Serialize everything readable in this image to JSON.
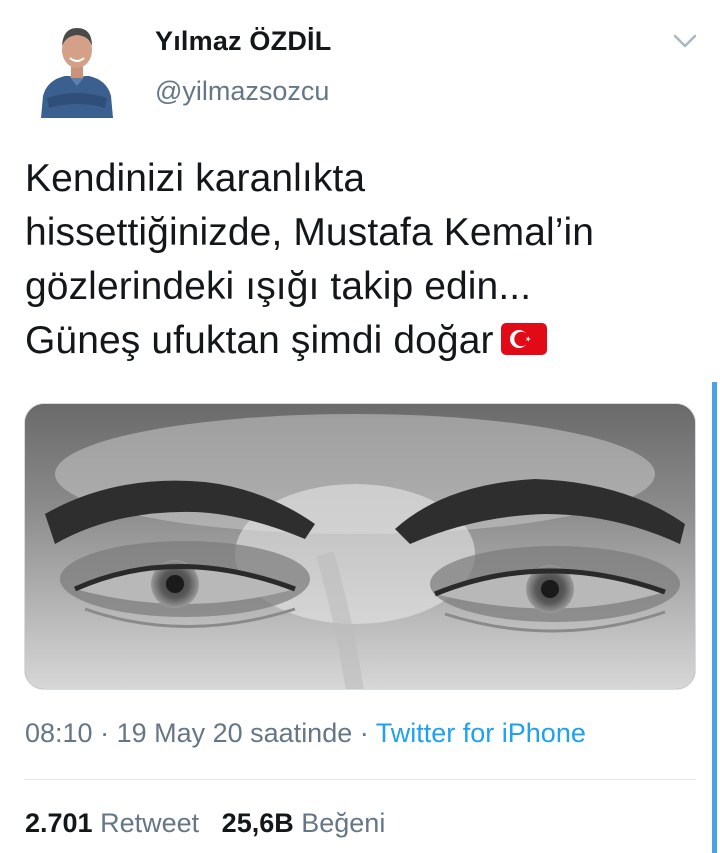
{
  "author": {
    "display_name": "Yılmaz ÖZDİL",
    "handle": "@yilmazsozcu"
  },
  "icons": {
    "avatar": "profile-photo",
    "menu": "chevron-down-icon",
    "flag": "turkish-flag-emoji"
  },
  "tweet": {
    "text_lines": [
      "Kendinizi karanlıkta",
      "hissettiğinizde, Mustafa Kemal’in",
      "gözlerindeki ışığı takip edin...",
      "Güneş ufuktan şimdi doğar"
    ]
  },
  "meta": {
    "time": "08:10",
    "separator": " · ",
    "date": "19 May 20 saatinde",
    "source": "Twitter for iPhone"
  },
  "stats": {
    "retweet_count": "2.701",
    "retweet_label": "Retweet",
    "like_count": "25,6B",
    "like_label": "Beğeni"
  },
  "colors": {
    "text": "#14171a",
    "secondary": "#657786",
    "link": "#1da1f2",
    "flag_red": "#e30a17"
  }
}
